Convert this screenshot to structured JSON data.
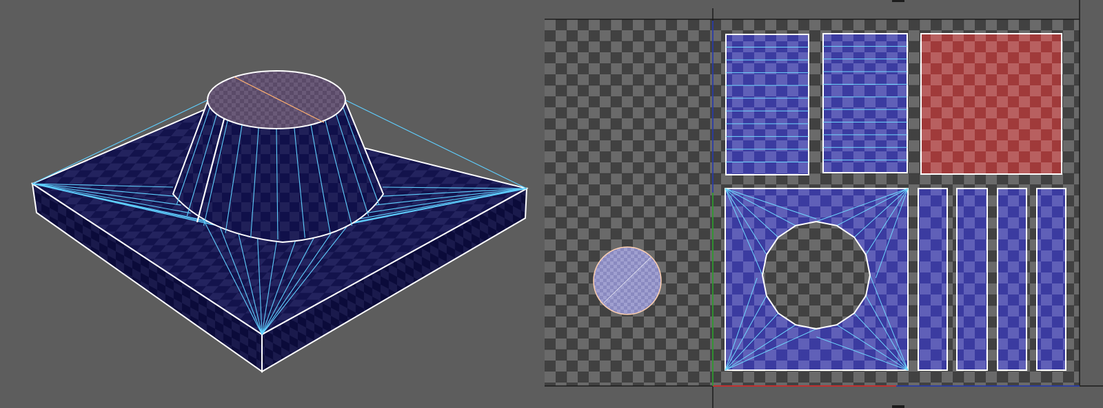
{
  "colors": {
    "background": "#5d5d5d",
    "checker_dark": "#3f3f3f",
    "checker_light": "#686868",
    "uv_blue_fill": "#3a3aaa",
    "uv_red_fill": "#b34040",
    "mesh_blue": "#141450",
    "wire_white": "#ffffff",
    "wire_cyan": "#5fcfff",
    "seam_orange": "#ffb070",
    "axis_u": "#c03030",
    "axis_v": "#2a40c0",
    "axis_green": "#30b030"
  },
  "viewport_3d": {
    "label": "",
    "object": "pedestal-mesh",
    "shading": "checker-texture",
    "wireframe": true
  },
  "uv_editor": {
    "label": "",
    "islands": [
      {
        "name": "side-strip-1",
        "selected": false,
        "color": "blue"
      },
      {
        "name": "side-strip-2",
        "selected": false,
        "color": "blue"
      },
      {
        "name": "top-face",
        "selected": true,
        "color": "red"
      },
      {
        "name": "base-top-with-hole",
        "selected": false,
        "color": "blue"
      },
      {
        "name": "edge-strip-1",
        "selected": false,
        "color": "blue"
      },
      {
        "name": "edge-strip-2",
        "selected": false,
        "color": "blue"
      },
      {
        "name": "edge-strip-3",
        "selected": false,
        "color": "blue"
      },
      {
        "name": "edge-strip-4",
        "selected": false,
        "color": "blue"
      },
      {
        "name": "cap-disc",
        "selected": false,
        "color": "white"
      }
    ]
  }
}
